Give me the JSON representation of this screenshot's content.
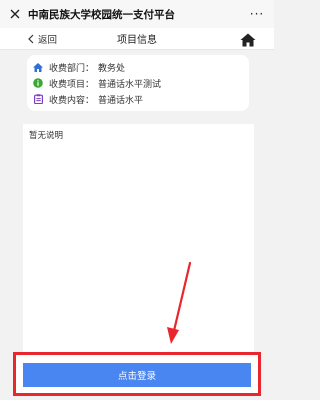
{
  "titlebar": {
    "title": "中南民族大学校园统一支付平台",
    "more_label": "···"
  },
  "navbar": {
    "back_label": "返回",
    "title": "项目信息"
  },
  "info": {
    "items": [
      {
        "label": "收费部门：",
        "value": "教务处",
        "icon": "home-icon"
      },
      {
        "label": "收费项目：",
        "value": "普通话水平测试",
        "icon": "info-icon"
      },
      {
        "label": "收费内容：",
        "value": "普通话水平",
        "icon": "clipboard-icon"
      }
    ]
  },
  "description": {
    "text": "暂无说明"
  },
  "footer": {
    "login_label": "点击登录"
  },
  "colors": {
    "accent": "#4a86f1",
    "highlight": "#e8262d",
    "home_icon": "#2f6fd6",
    "info_icon": "#3aaa35",
    "clipboard_icon": "#7b3fc4"
  }
}
